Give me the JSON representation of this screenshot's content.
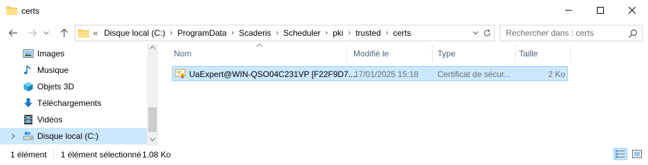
{
  "window": {
    "title": "certs",
    "controls": {
      "minimize_icon": "minimize-icon",
      "maximize_icon": "maximize-icon",
      "close_icon": "close-icon"
    }
  },
  "toolbar": {
    "back_icon": "arrow-left-icon",
    "forward_icon": "arrow-right-icon",
    "recent_icon": "chevron-down-icon",
    "up_icon": "arrow-up-icon"
  },
  "address": {
    "overflow": "«",
    "crumbs": [
      "Disque local (C:)",
      "ProgramData",
      "Scaderis",
      "Scheduler",
      "pki",
      "trusted",
      "certs"
    ],
    "separator": "›"
  },
  "search": {
    "placeholder": "Rechercher dans : certs"
  },
  "sidebar": {
    "items": [
      {
        "label": "Images",
        "icon": "pictures-icon"
      },
      {
        "label": "Musique",
        "icon": "music-note-icon"
      },
      {
        "label": "Objets 3D",
        "icon": "cube-3d-icon"
      },
      {
        "label": "Téléchargements",
        "icon": "download-arrow-icon"
      },
      {
        "label": "Vidéos",
        "icon": "film-icon"
      },
      {
        "label": "Disque local (C:)",
        "icon": "drive-icon",
        "selected": true
      }
    ]
  },
  "columns": {
    "name": "Nom",
    "modified": "Modifié le",
    "type": "Type",
    "size": "Taille"
  },
  "files": [
    {
      "name": "UaExpert@WIN-QSO04C231VP [F22F9D7...",
      "modified": "17/01/2025 15:18",
      "type": "Certificat de sécur...",
      "size": "2 Ko",
      "icon": "certificate-icon"
    }
  ],
  "status": {
    "count": "1 élément",
    "selected": "1 élément sélectionné",
    "size": "1.08 Ko"
  },
  "colors": {
    "selection_bg": "#cce8ff",
    "selection_border": "#99d1ff",
    "header_text": "#4c607a",
    "folder_yellow": "#ffd35c"
  }
}
